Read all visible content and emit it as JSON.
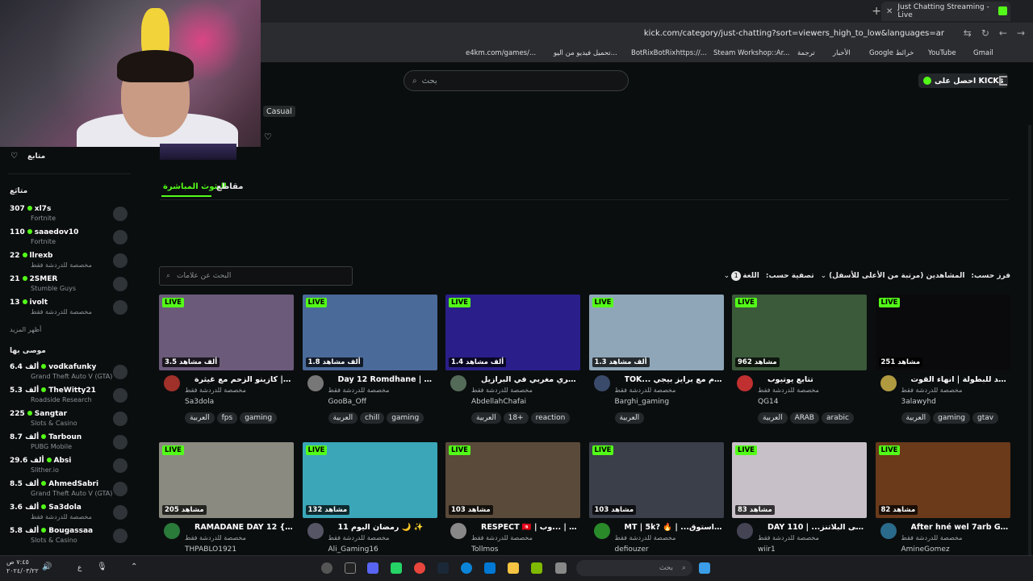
{
  "browser": {
    "tab_title": "Just Chatting Streaming - Live",
    "url": "kick.com/category/just-chatting?sort=viewers_high_to_low&languages=ar",
    "new_tab": "+",
    "tab_close": "✕",
    "nav_icons": [
      "⇆",
      "↻",
      "←",
      "→"
    ]
  },
  "bookmarks": [
    {
      "label": "Gmail"
    },
    {
      "label": "YouTube"
    },
    {
      "label": "Google خرائط"
    },
    {
      "label": "الأخبار"
    },
    {
      "label": "ترجمة"
    },
    {
      "label": "Steam Workshop::Ar..."
    },
    {
      "label": "BotRixBotRixhttps://..."
    },
    {
      "label": "تحميل فيديو من اليو..."
    },
    {
      "label": "e4km.com/games/..."
    }
  ],
  "header": {
    "search_placeholder": "بحث",
    "get_kicks": "احصل على KICKs"
  },
  "category": {
    "tag": "Casual",
    "tabs": {
      "live": "البثوث المباشرة",
      "clips": "مقاطع"
    },
    "tag_search_placeholder": "البحث عن علامات",
    "sort_label": "فرز حسب:",
    "sort_value": "المشاهدين (مرتبة من الأعلى للأسفل)",
    "filter_label": "تصفية حسب:",
    "language_label": "اللغة",
    "language_count": "1"
  },
  "sidebar": {
    "following_title": "متابع",
    "following_section": "متابَع",
    "following": [
      {
        "count": "307",
        "name": "xl7s",
        "category": "Fortnite"
      },
      {
        "count": "110",
        "name": "saaedov10",
        "category": "Fortnite"
      },
      {
        "count": "22",
        "name": "llrexb",
        "category": "مخصصة للدردشة فقط"
      },
      {
        "count": "21",
        "name": "2SMER",
        "category": "Stumble Guys"
      },
      {
        "count": "13",
        "name": "ivolt",
        "category": "مخصصة للدردشة فقط"
      }
    ],
    "show_more": "أظهر المزيد",
    "recommended_title": "موصى بها",
    "recommended": [
      {
        "count": "6.4 ألف",
        "name": "vodkafunky",
        "category": "Grand Theft Auto V (GTA)"
      },
      {
        "count": "5.3 ألف",
        "name": "TheWitty21",
        "category": "Roadside Research"
      },
      {
        "count": "225",
        "name": "Sangtar",
        "category": "Slots & Casino"
      },
      {
        "count": "8.7 ألف",
        "name": "Tarboun",
        "category": "PUBG Mobile"
      },
      {
        "count": "29.6 ألف",
        "name": "Absi",
        "category": "Slither.io"
      },
      {
        "count": "8.5 ألف",
        "name": "AhmedSabri",
        "category": "Grand Theft Auto V (GTA)"
      },
      {
        "count": "3.6 ألف",
        "name": "Sa3dola",
        "category": "مخصصة للدردشة فقط"
      },
      {
        "count": "5.8 ألف",
        "name": "Bougassaa",
        "category": "Slots & Casino"
      }
    ]
  },
  "live_badge": "LIVE",
  "streams": [
    {
      "viewers": "3.5 ألف مشاهد",
      "title": "كازينو الزحم مع غيثرة | ...",
      "user": "Sa3dola",
      "category": "مخصصة للدردشة فقط",
      "tags": [
        "العربية",
        "fps",
        "gaming"
      ],
      "thumb": "#6b5a7a",
      "avatar": "#a0302a"
    },
    {
      "viewers": "1.8 ألف مشاهد",
      "title": "Day 12 Romdhane | Az...",
      "user": "GooBa_Off",
      "category": "مخصصة للدردشة فقط",
      "tags": [
        "العربية",
        "chill",
        "gaming"
      ],
      "thumb": "#4a6a9a",
      "avatar": "#777"
    },
    {
      "viewers": "1.4 ألف مشاهد",
      "title": "عسكري مغربي في البرازيل ...BR",
      "user": "AbdellahChafai",
      "category": "مخصصة للدردشة فقط",
      "tags": [
        "العربية",
        "18+",
        "reaction"
      ],
      "thumb": "#2a1f8a",
      "avatar": "#556b5a"
    },
    {
      "viewers": "1.3 ألف مشاهد",
      "title": "TOK... قيس كام مع برايز بيجي",
      "user": "Barghi_gaming",
      "category": "مخصصة للدردشة فقط",
      "tags": [
        "العربية"
      ],
      "thumb": "#8fa6b8",
      "avatar": "#3a4a6a"
    },
    {
      "viewers": "962 مشاهد",
      "title": "تتابع يوتيوب",
      "user": "QG14",
      "category": "مخصصة للدردشة فقط",
      "tags": [
        "العربية",
        "ARAB",
        "arabic"
      ],
      "thumb": "#3a5a3a",
      "avatar": "#c03030"
    },
    {
      "viewers": "251 مشاهد",
      "title": "رنستعد للبطولة | انهاء القوت",
      "user": "3alawyhd",
      "category": "مخصصة للدردشة فقط",
      "tags": [
        "العربية",
        "gaming",
        "gtav"
      ],
      "thumb": "#0a0a0c",
      "avatar": "#b09a40"
    },
    {
      "viewers": "205 مشاهد",
      "title": "RAMADANE DAY 12 {s...",
      "user": "THPABLO1921",
      "category": "مخصصة للدردشة فقط",
      "tags": [],
      "thumb": "#8a8a80",
      "avatar": "#2a7a3a"
    },
    {
      "viewers": "132 مشاهد",
      "title": "رمضان اليوم 11 🌙 ✨",
      "user": "Ali_Gaming16",
      "category": "مخصصة للدردشة فقط",
      "tags": [],
      "thumb": "#3aa6b8",
      "avatar": "#556"
    },
    {
      "viewers": "103 مشاهد",
      "title": "RESPECT 🇹🇳 | اصحكة | ...وب",
      "user": "Tollmos",
      "category": "مخصصة للدردشة فقط",
      "tags": [],
      "thumb": "#5a4a3a",
      "avatar": "#888"
    },
    {
      "viewers": "103 مشاهد",
      "title": "MT | 5k? 🔥 | ...ك واستوق",
      "user": "defiouzer",
      "category": "مخصصة للدردشة فقط",
      "tags": [],
      "thumb": "#3a3f4a",
      "avatar": "#2a8a2a"
    },
    {
      "viewers": "83 مشاهد",
      "title": "DAY 110 | ...ق الى البلاتنز",
      "user": "wiir1",
      "category": "مخصصة للدردشة فقط",
      "tags": [],
      "thumb": "#c8c0c8",
      "avatar": "#445"
    },
    {
      "viewers": "82 مشاهد",
      "title": "After hné wel 7arb Gh...",
      "user": "AmineGomez",
      "category": "مخصصة للدردشة فقط",
      "tags": [],
      "thumb": "#6a3a1a",
      "avatar": "#2a6a8a"
    }
  ],
  "taskbar": {
    "search_placeholder": "بحث",
    "clock_time": "٧:٤٥ ص",
    "clock_date": "٢٠٢٤/٠٣/٢٢",
    "lang": "ع"
  },
  "colors": {
    "accent": "#53fc18",
    "bg": "#0b0e0f",
    "tag_bg": "#25292c"
  }
}
